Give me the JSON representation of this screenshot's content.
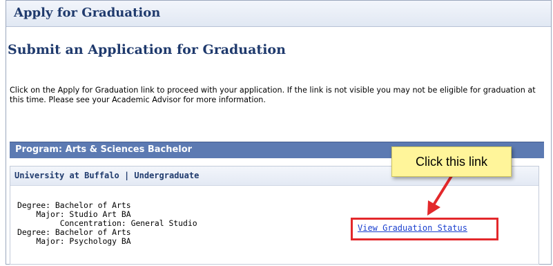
{
  "header": {
    "section_title": "Apply for Graduation"
  },
  "main": {
    "page_title": "Submit an Application for Graduation",
    "instructions": "Click on the Apply for Graduation link to proceed with your application. If the link is not visible you may not be eligible for graduation at this time. Please see your Academic Advisor for more information."
  },
  "program": {
    "label": "Program: Arts & Sciences Bachelor",
    "career": "University at Buffalo | Undergraduate",
    "plans": [
      "Degree: Bachelor of Arts",
      "    Major: Studio Art BA",
      "         Concentration: General Studio",
      "Degree: Bachelor of Arts",
      "    Major: Psychology BA"
    ],
    "link_label": "View Graduation Status"
  },
  "annotation": {
    "callout_text": "Click this link",
    "callout_color": "#fff59a",
    "highlight_color": "#e3282b",
    "arrow_color": "#e3282b"
  }
}
